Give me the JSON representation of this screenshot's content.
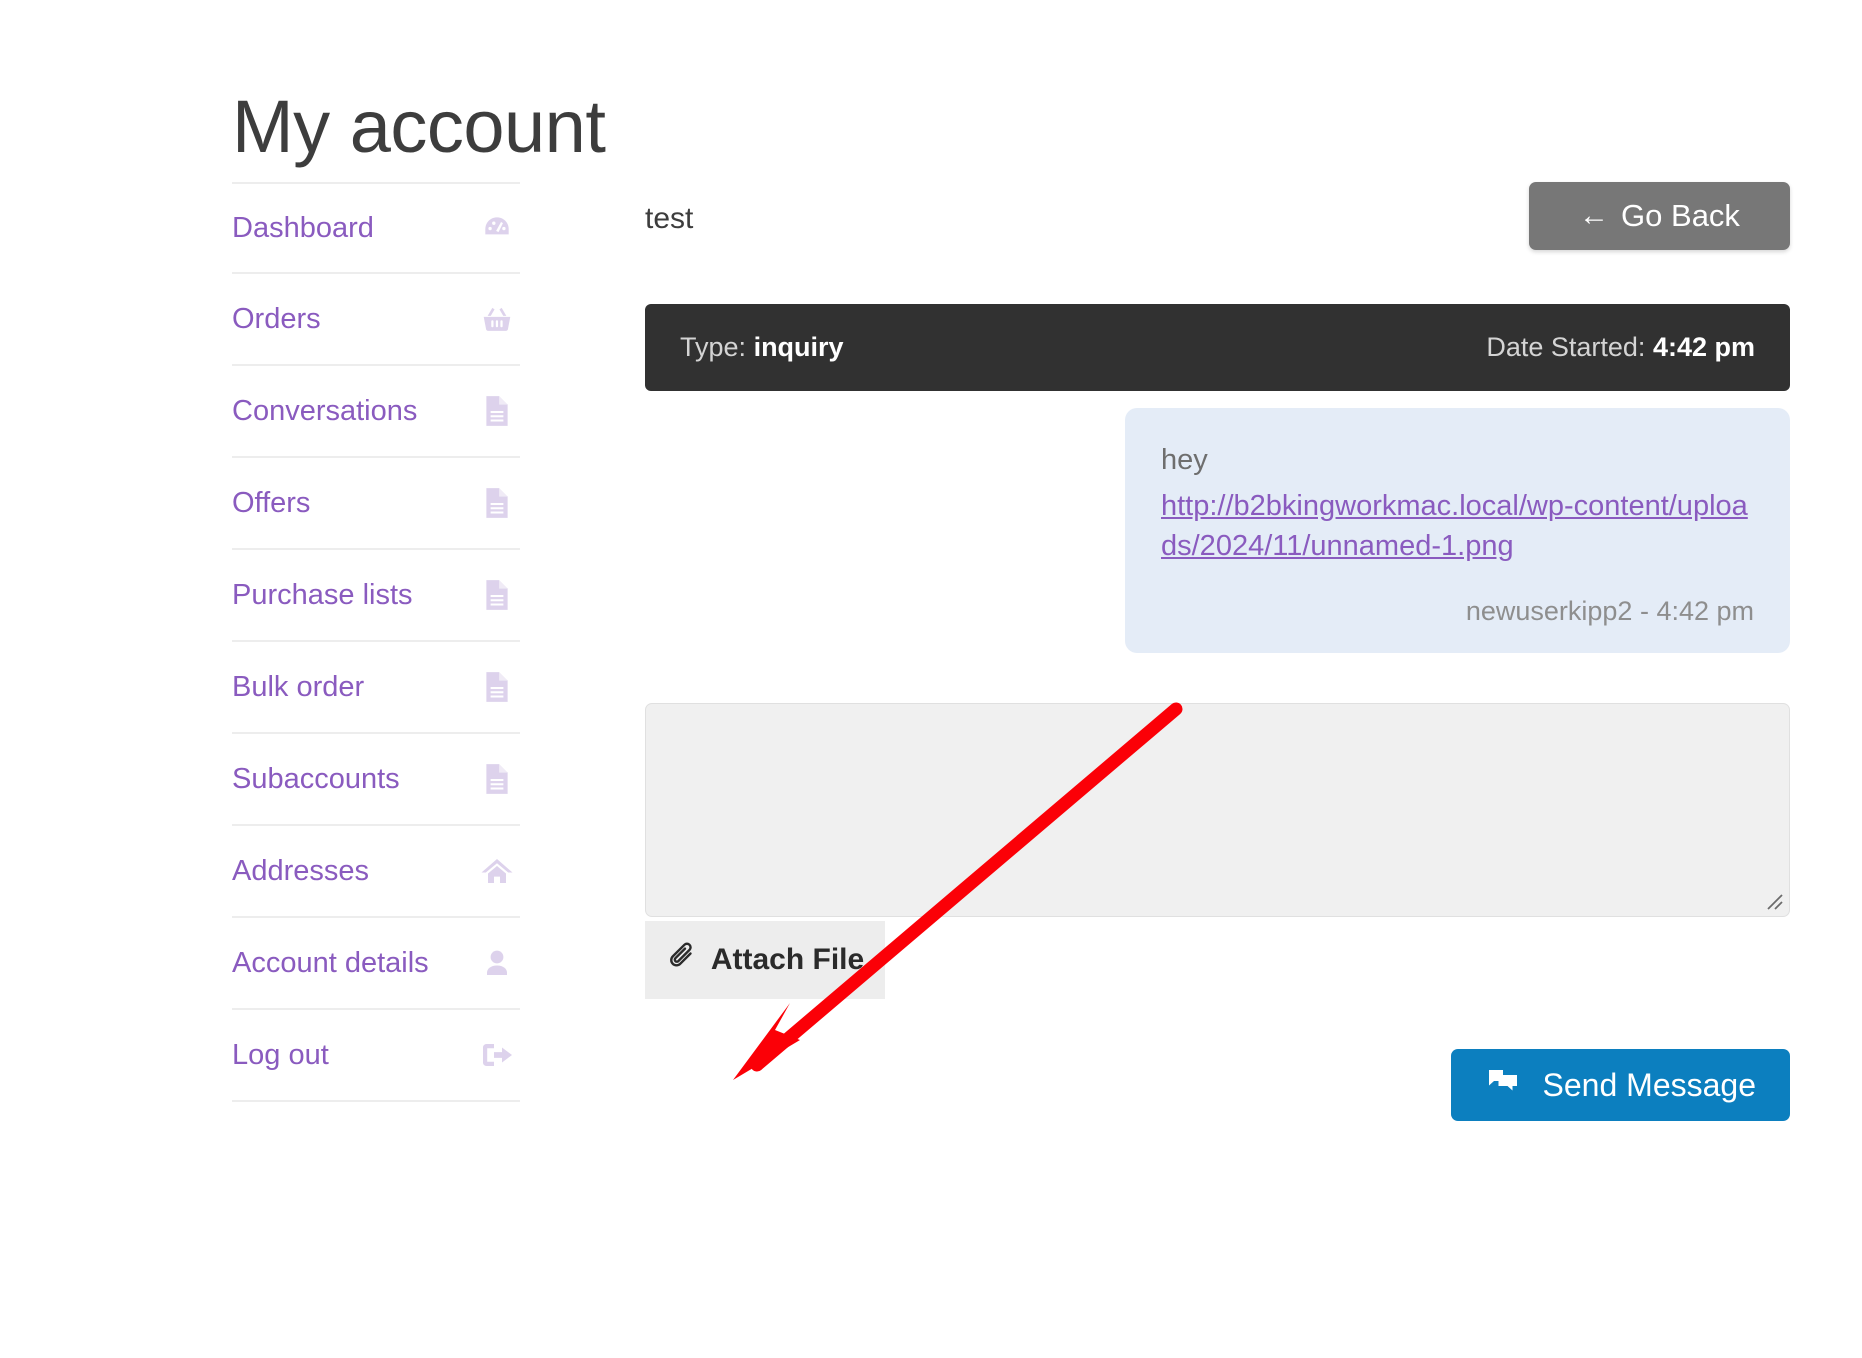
{
  "page": {
    "title": "My account"
  },
  "sidebar": {
    "items": [
      {
        "label": "Dashboard",
        "icon": "dashboard-gauge-icon"
      },
      {
        "label": "Orders",
        "icon": "shopping-basket-icon"
      },
      {
        "label": "Conversations",
        "icon": "document-icon"
      },
      {
        "label": "Offers",
        "icon": "document-icon"
      },
      {
        "label": "Purchase lists",
        "icon": "document-icon"
      },
      {
        "label": "Bulk order",
        "icon": "document-icon"
      },
      {
        "label": "Subaccounts",
        "icon": "document-icon"
      },
      {
        "label": "Addresses",
        "icon": "home-icon"
      },
      {
        "label": "Account details",
        "icon": "user-icon"
      },
      {
        "label": "Log out",
        "icon": "sign-out-icon"
      }
    ]
  },
  "conversation": {
    "subject": "test",
    "go_back_label": "Go Back",
    "go_back_arrow": "←",
    "meta": {
      "type_key": "Type:",
      "type_value": "inquiry",
      "date_key": "Date Started:",
      "date_value": "4:42 pm"
    },
    "messages": [
      {
        "text": "hey",
        "link": "http://b2bkingworkmac.local/wp-content/uploads/2024/11/unnamed-1.png",
        "signature": "newuserkipp2 - 4:42 pm"
      }
    ],
    "reply": {
      "value": "",
      "placeholder": "",
      "attach_label": "Attach File",
      "send_label": "Send Message"
    }
  },
  "colors": {
    "link_purple": "#8a5bbf",
    "icon_lavender": "#ddd2ec",
    "meta_bar_dark": "#313131",
    "bubble_blue": "#e4ecf7",
    "send_blue": "#0c7fbf",
    "go_back_gray": "#777777",
    "annotation_red": "#fb0007"
  }
}
